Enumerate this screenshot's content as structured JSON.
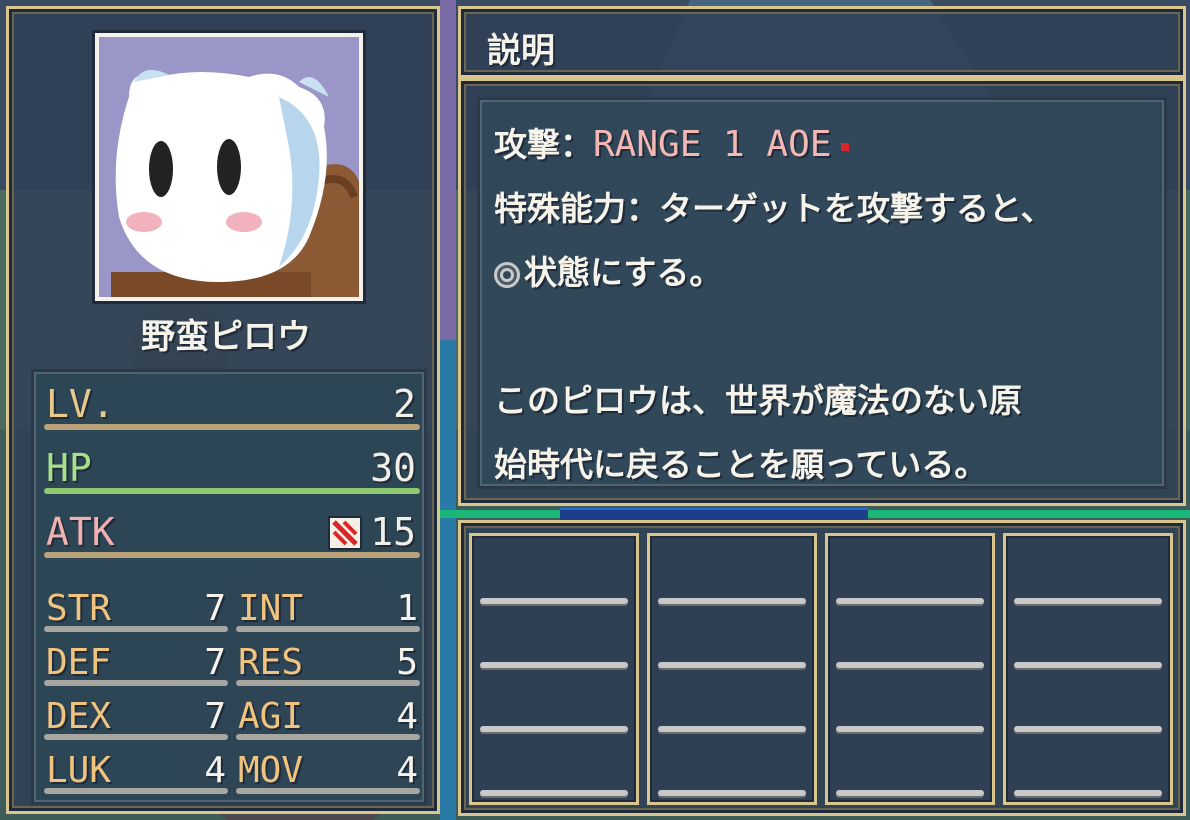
{
  "character": {
    "name": "野蛮ピロウ",
    "portrait": "white-bear-ghost-with-staff"
  },
  "main_stats": [
    {
      "label": "LV.",
      "value": "2",
      "bar_color": "#b9a27a"
    },
    {
      "label": "HP",
      "value": "30",
      "bar_color": "#8fca6e"
    },
    {
      "label": "ATK",
      "value": "15",
      "bar_color": "#b9a27a",
      "icon": "slash-attack-icon"
    }
  ],
  "sub_stats": [
    {
      "label": "STR",
      "value": "7"
    },
    {
      "label": "INT",
      "value": "1"
    },
    {
      "label": "DEF",
      "value": "7"
    },
    {
      "label": "RES",
      "value": "5"
    },
    {
      "label": "DEX",
      "value": "7"
    },
    {
      "label": "AGI",
      "value": "4"
    },
    {
      "label": "LUK",
      "value": "4"
    },
    {
      "label": "MOV",
      "value": "4"
    }
  ],
  "description": {
    "header": "説明",
    "attack_label": "攻撃：",
    "attack_value": "RANGE 1 AOE",
    "ability_label": "特殊能力：",
    "ability_text_1": "ターゲットを攻撃すると、",
    "ability_text_2": "状態にする。",
    "ability_icon": "spiral-status-icon",
    "flavor_1": "このピロウは、世界が魔法のない原",
    "flavor_2": "始時代に戻ることを願っている。"
  },
  "slots": {
    "count": 4,
    "lines_per_slot": 4
  },
  "colors": {
    "frame": "#d9c58e",
    "panel": "#2e3e56",
    "stat_label": "#f0c37e",
    "range_text": "#f4b8b4"
  }
}
